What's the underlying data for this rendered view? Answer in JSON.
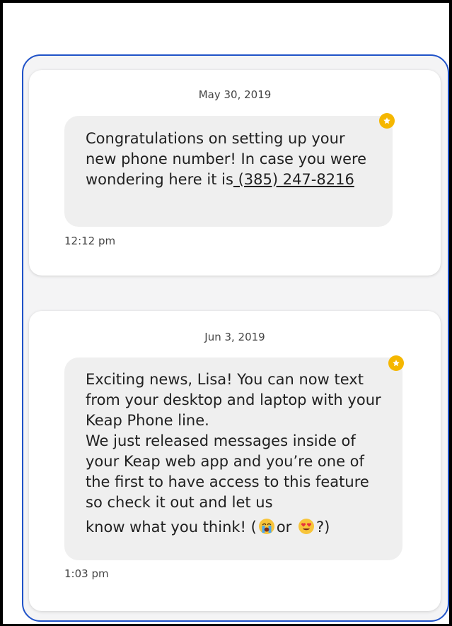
{
  "messages": [
    {
      "date": "May 30, 2019",
      "text_before_link": "Congratulations on setting up your new phone number! In case you were wondering here it is",
      "link_text": " (385) 247-8216",
      "time": "12:12 pm",
      "badge_icon": "star-icon"
    },
    {
      "date": "Jun 3, 2019",
      "text_main": "Exciting news, Lisa! You can now text from your desktop and laptop with your Keap Phone line.\nWe just released messages inside of your Keap web app and you’re one of the first to have access to this feature so check it out and let us",
      "text_end_prefix": "know what you think! (",
      "text_end_middle": "or ",
      "text_end_suffix": "?)",
      "emoji_1": "crying-face-emoji",
      "emoji_2": "heart-eyes-emoji",
      "time": "1:03 pm",
      "badge_icon": "star-icon"
    }
  ],
  "colors": {
    "frame_border": "#1f52c8",
    "star_badge": "#f5b700",
    "bubble_bg": "#efefef"
  }
}
